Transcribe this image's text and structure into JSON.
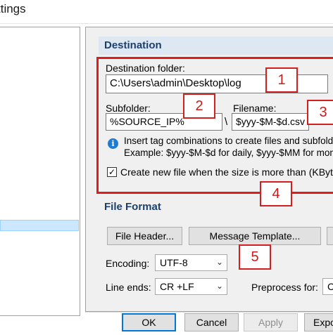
{
  "window": {
    "title": "ttings"
  },
  "destination": {
    "header": "Destination",
    "folder_label": "Destination folder:",
    "folder_value": "C:\\Users\\admin\\Desktop\\log",
    "subfolder_label": "Subfolder:",
    "subfolder_value": "%SOURCE_IP%",
    "separator": "\\",
    "filename_label": "Filename:",
    "filename_value": "$yyy-$M-$d.csv",
    "info_line1": "Insert tag combinations to create files and subfolde",
    "info_line2": "Example: $yyy-$M-$d for daily, $yyy-$MM for mont",
    "create_new_file_label": "Create new file when the size is more than (KBytes):",
    "create_new_file_checked": true
  },
  "file_format": {
    "header": "File Format",
    "file_header_button": "File Header...",
    "message_template_button": "Message Template...",
    "encoding_label": "Encoding:",
    "encoding_value": "UTF-8",
    "line_ends_label": "Line ends:",
    "line_ends_value": "CR +LF",
    "preprocess_label": "Preprocess for:",
    "preprocess_value": "CS"
  },
  "footer": {
    "ok": "OK",
    "cancel": "Cancel",
    "apply": "Apply",
    "export": "Expo"
  },
  "callouts": [
    "1",
    "2",
    "3",
    "4",
    "5"
  ],
  "colors": {
    "annotation_red": "#e01d1d",
    "header_band": "#dde8f3",
    "header_text": "#1c3f6b",
    "selection": "#cce8ff"
  }
}
